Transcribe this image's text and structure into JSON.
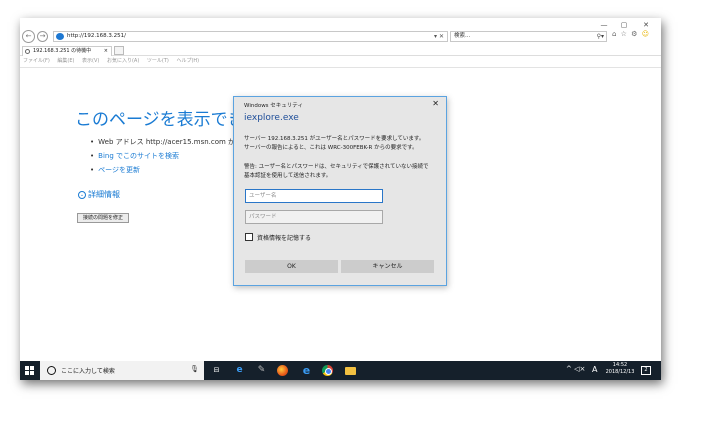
{
  "window": {
    "min": "—",
    "max": "▢",
    "close": "✕"
  },
  "nav": {
    "back": "←",
    "forward": "→"
  },
  "address": {
    "url": "http://192.168.3.251/",
    "controls": "▾ ✕"
  },
  "search": {
    "placeholder": "検索...",
    "icon": "⚲▾"
  },
  "toolbar": {
    "icons": "⌂ ☆ ⚙",
    "smiley": "☺"
  },
  "tab": {
    "title": "192.168.3.251 の待機中",
    "close": "×"
  },
  "menu": [
    "ファイル(F)",
    "編集(E)",
    "表示(V)",
    "お気に入り(A)",
    "ツール(T)",
    "ヘルプ(H)"
  ],
  "error_page": {
    "title": "このページを表示できませ",
    "bullet1": "Web アドレス http://acer15.msn.com が正しい",
    "bullet2": "Bing でこのサイトを検索",
    "bullet3": "ページを更新",
    "details": "詳細情報",
    "fix_button": "接続の問題を修正"
  },
  "dialog": {
    "caption": "Windows セキュリティ",
    "close": "✕",
    "app": "iexplore.exe",
    "message_line1": "サーバー 192.168.3.251 がユーザー名とパスワードを要求しています。",
    "message_line2": "サーバーの報告によると、これは WRC-300FEBK-R からの要求です。",
    "warning_line1": "警告: ユーザー名とパスワードは、セキュリティで保護されていない接続で",
    "warning_line2": "基本認証を使用して送信されます。",
    "username_placeholder": "ユーザー名",
    "password_placeholder": "パスワード",
    "remember": "資格情報を記憶する",
    "ok": "OK",
    "cancel": "キャンセル"
  },
  "taskbar": {
    "search_text": "ここに入力して検索",
    "mic": "🎙",
    "taskview": "⊟",
    "edge": "e",
    "gimp": "✎",
    "ie": "e",
    "tray": "^ ◁×",
    "ime": "A",
    "time": "14:52",
    "date": "2018/12/13",
    "notif": "2"
  },
  "colors": {
    "accent": "#1a7bd3",
    "taskbar": "#15202b",
    "dialog_bg": "#e6e6e6",
    "dialog_border": "#5ba3e0"
  }
}
